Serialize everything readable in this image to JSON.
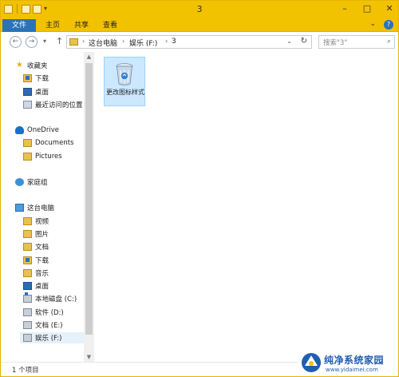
{
  "window": {
    "title": "3"
  },
  "ribbon": {
    "file_tab": "文件",
    "tabs": [
      "主页",
      "共享",
      "查看"
    ]
  },
  "address": {
    "crumbs": [
      "这台电脑",
      "娱乐 (F:)",
      "3"
    ],
    "search_placeholder": "搜索\"3\""
  },
  "nav": {
    "favorites": {
      "label": "收藏夹",
      "items": [
        "下载",
        "桌面",
        "最近访问的位置"
      ]
    },
    "onedrive": {
      "label": "OneDrive",
      "items": [
        "Documents",
        "Pictures"
      ]
    },
    "homegroup": {
      "label": "家庭组"
    },
    "thispc": {
      "label": "这台电脑",
      "items": [
        "视频",
        "图片",
        "文档",
        "下载",
        "音乐",
        "桌面",
        "本地磁盘 (C:)",
        "软件 (D:)",
        "文档 (E:)",
        "娱乐 (F:)"
      ]
    }
  },
  "content": {
    "items": [
      {
        "name": "更改图标样式",
        "icon": "recycle-bin-icon"
      }
    ]
  },
  "status": {
    "count": "1 个项目"
  },
  "watermark": {
    "title": "纯净系统家园",
    "url": "www.yidaimei.com"
  },
  "colors": {
    "title_bar": "#f2c200",
    "file_tab": "#2a73b8",
    "selection": "#cce8ff"
  }
}
